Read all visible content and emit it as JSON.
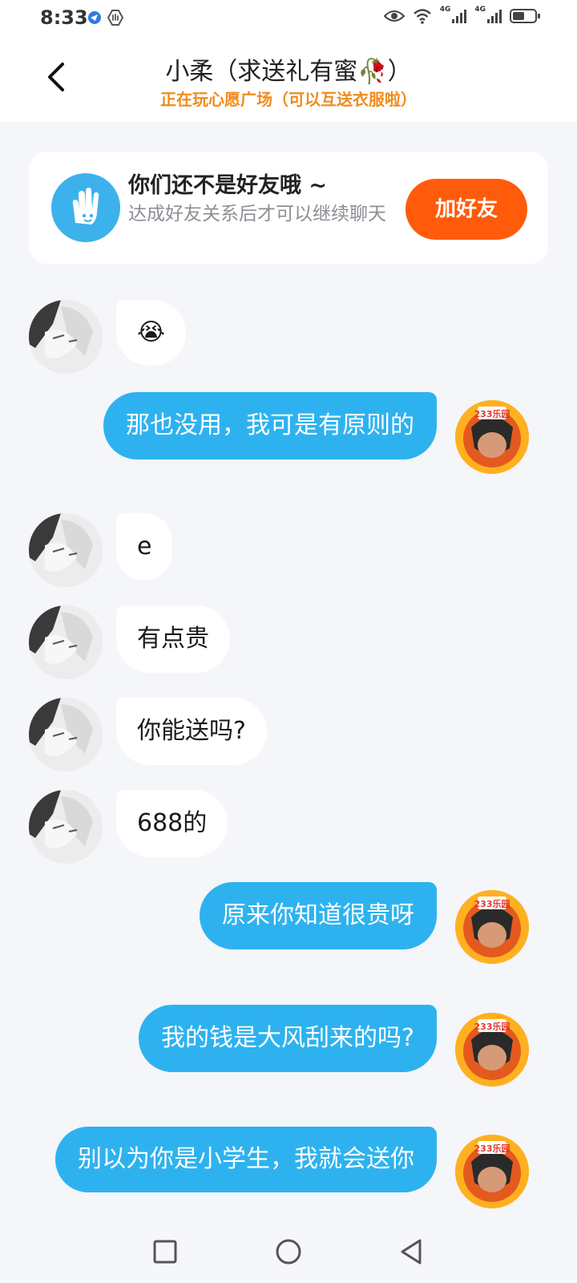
{
  "status_bar": {
    "time": "8:33",
    "network_1": "4G",
    "network_2": "4G"
  },
  "header": {
    "title": "小柔（求送礼有蜜🥀）",
    "subtitle": "正在玩心愿广场（可以互送衣服啦）"
  },
  "friend_card": {
    "title": "你们还不是好友哦 ~",
    "description": "达成好友关系后才可以继续聊天",
    "add_button": "加好友"
  },
  "messages": [
    {
      "from": "them",
      "text": "😭"
    },
    {
      "from": "me",
      "text": "那也没用，我可是有原则的"
    },
    {
      "from": "them",
      "text": "e"
    },
    {
      "from": "them",
      "text": "有点贵"
    },
    {
      "from": "them",
      "text": "你能送吗?"
    },
    {
      "from": "them",
      "text": "688的"
    },
    {
      "from": "me",
      "text": "原来你知道很贵呀"
    },
    {
      "from": "me",
      "text": "我的钱是大风刮来的吗?"
    },
    {
      "from": "me",
      "text": "别以为你是小学生，我就会送你"
    }
  ],
  "my_avatar_badge": "233乐园",
  "colors": {
    "accent_blue": "#2eb2ef",
    "add_button_orange": "#ff5b0a",
    "subtitle_orange": "#f08a1c"
  }
}
